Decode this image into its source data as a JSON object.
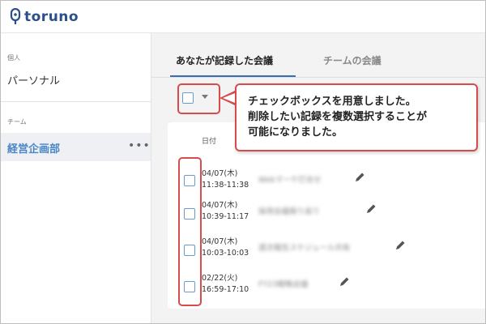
{
  "app": {
    "name": "toruno",
    "logo_icon": "microphone-pin-icon",
    "accent": "#3b6db3",
    "annotation_color": "#d64b4b"
  },
  "sidebar": {
    "sections": [
      {
        "label": "個人",
        "items": [
          {
            "label": "パーソナル"
          }
        ]
      },
      {
        "label": "チーム",
        "items": [
          {
            "label": "経営企画部",
            "active": true,
            "more_icon": "more-horizontal-icon",
            "more_label": "•••"
          }
        ]
      }
    ]
  },
  "main": {
    "tabs": [
      {
        "label": "あなたが記録した会議",
        "active": true
      },
      {
        "label": "チームの会議",
        "active": false
      }
    ],
    "bulk_select": {
      "checked": false,
      "dropdown_icon": "caret-down-icon"
    },
    "list": {
      "date_header": "日付",
      "rows": [
        {
          "date": "04/07(木)",
          "time": "11:38-11:38",
          "title": "Webマーケ打合せ",
          "edit_icon": "pencil-icon",
          "checked": false
        },
        {
          "date": "04/07(木)",
          "time": "10:39-11:17",
          "title": "採用会議振り返り",
          "edit_icon": "pencil-icon",
          "checked": false
        },
        {
          "date": "04/07(木)",
          "time": "10:03-10:03",
          "title": "週次報告スケジュール共有",
          "edit_icon": "pencil-icon",
          "checked": false
        },
        {
          "date": "02/22(火)",
          "time": "16:59-17:10",
          "title": "FY23戦略会議",
          "edit_icon": "pencil-icon",
          "checked": false
        }
      ]
    }
  },
  "callout": {
    "lines": [
      "チェックボックスを用意しました。",
      "削除したい記録を複数選択することが",
      "可能になりました。"
    ]
  }
}
